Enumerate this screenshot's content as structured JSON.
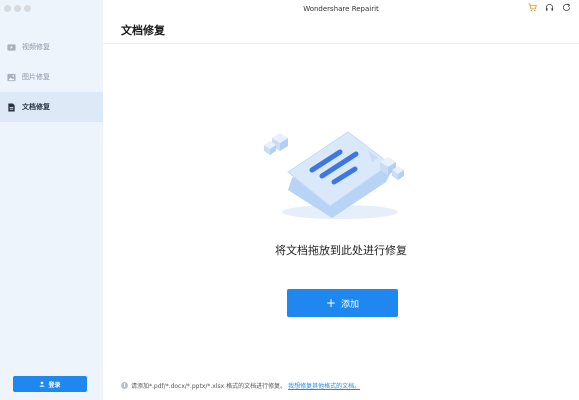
{
  "window": {
    "title": "Wondershare Repairit"
  },
  "sidebar": {
    "items": [
      {
        "label": "视频修复",
        "icon": "video-icon",
        "active": false
      },
      {
        "label": "图片修复",
        "icon": "image-icon",
        "active": false
      },
      {
        "label": "文档修复",
        "icon": "document-icon",
        "active": true
      }
    ],
    "login_label": "登录"
  },
  "header": {
    "icons": [
      "cart-icon",
      "headset-icon",
      "refresh-icon"
    ]
  },
  "main": {
    "title": "文档修复",
    "drop_text": "将文档拖放到此处进行修复",
    "add_label": "添加",
    "hint_text": "请添加*.pdf/*.docx/*.pptx/*.xlsx 格式的文档进行修复。",
    "hint_link": "我想修复其他格式的文档。"
  },
  "colors": {
    "accent": "#1e88f0",
    "sidebar_bg": "#eef4fb",
    "active_bg": "#dde9f7"
  }
}
